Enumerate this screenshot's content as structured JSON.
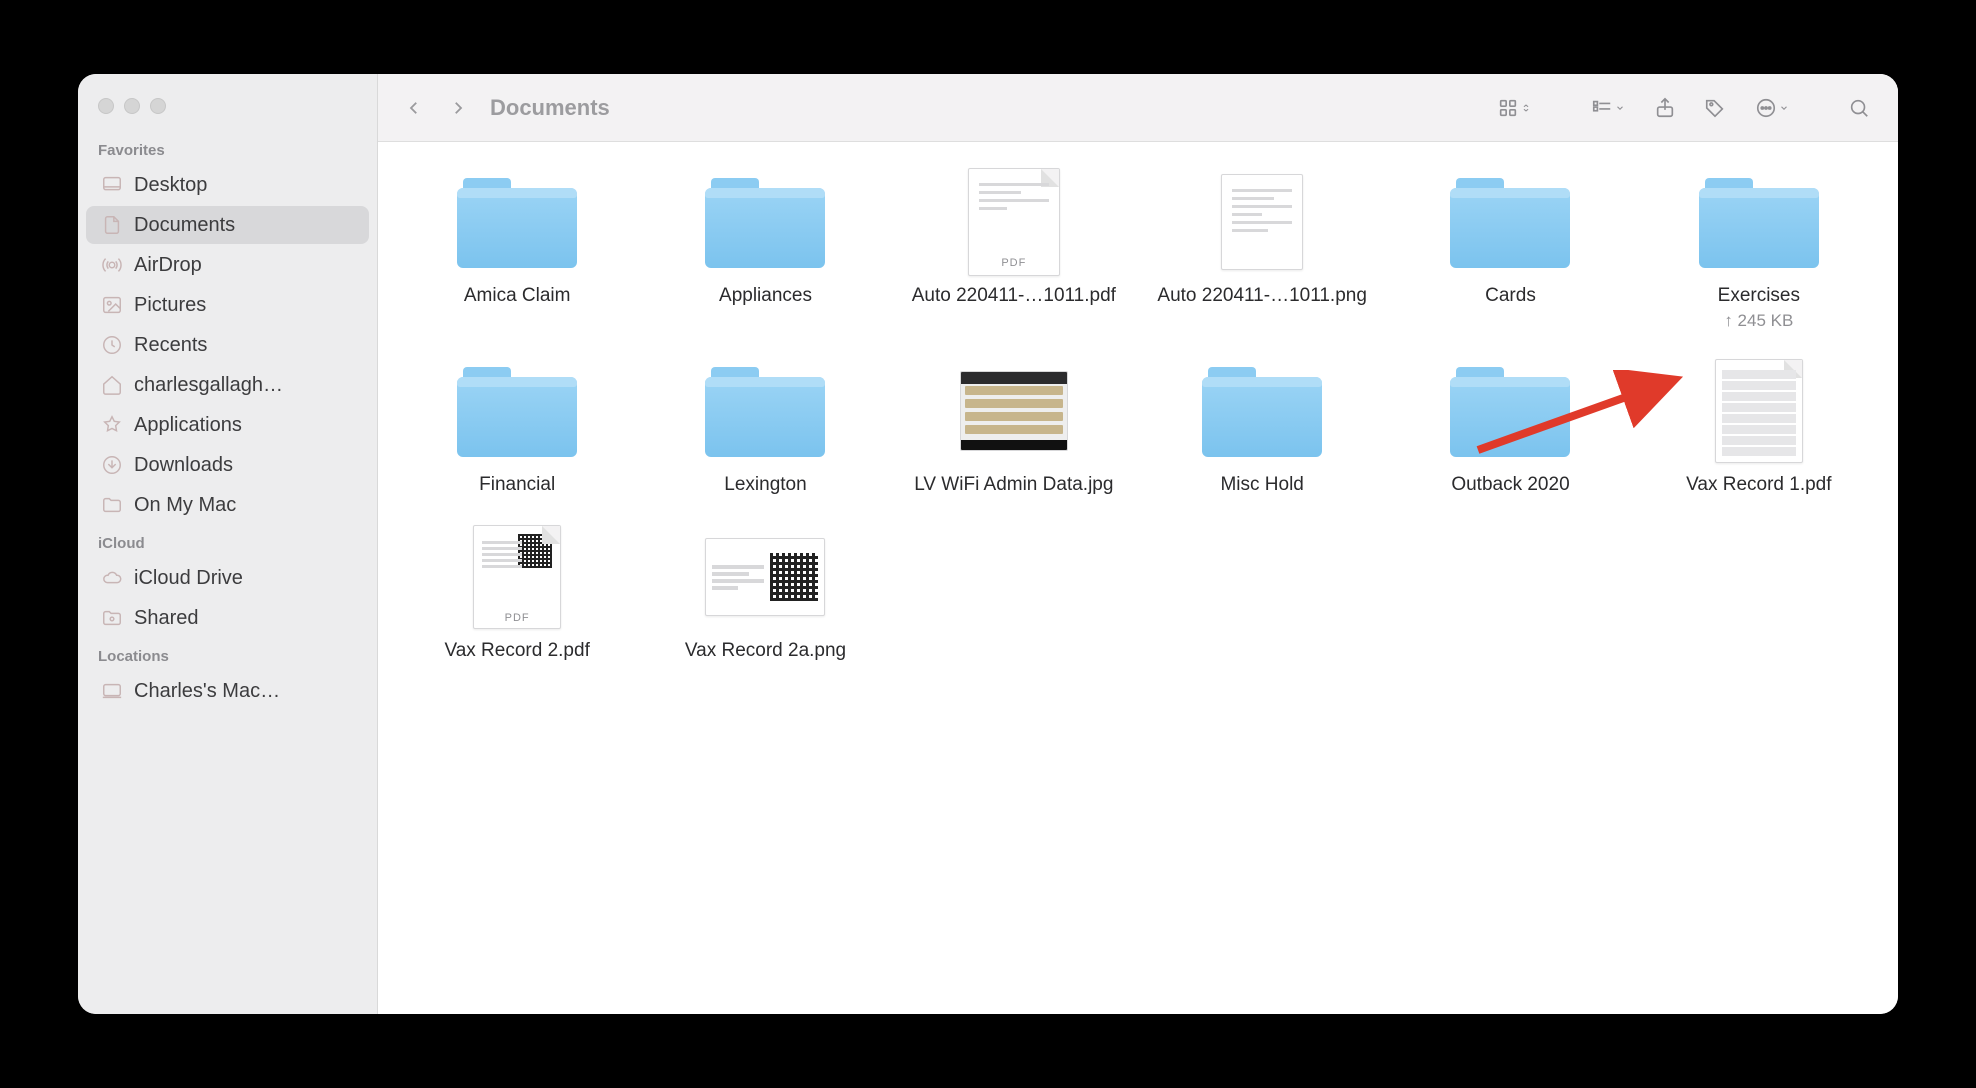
{
  "window": {
    "title": "Documents"
  },
  "sidebar": {
    "sections": [
      {
        "label": "Favorites",
        "items": [
          {
            "icon": "desktop",
            "label": "Desktop"
          },
          {
            "icon": "document",
            "label": "Documents",
            "selected": true
          },
          {
            "icon": "airdrop",
            "label": "AirDrop"
          },
          {
            "icon": "pictures",
            "label": "Pictures"
          },
          {
            "icon": "recents",
            "label": "Recents"
          },
          {
            "icon": "home",
            "label": "charlesgallagh…"
          },
          {
            "icon": "applications",
            "label": "Applications"
          },
          {
            "icon": "downloads",
            "label": "Downloads"
          },
          {
            "icon": "folder",
            "label": "On My Mac"
          }
        ]
      },
      {
        "label": "iCloud",
        "items": [
          {
            "icon": "cloud",
            "label": "iCloud Drive"
          },
          {
            "icon": "shared",
            "label": "Shared"
          }
        ]
      },
      {
        "label": "Locations",
        "items": [
          {
            "icon": "mac",
            "label": "Charles's Mac…"
          }
        ]
      }
    ]
  },
  "items": [
    {
      "type": "folder",
      "name": "Amica Claim"
    },
    {
      "type": "folder",
      "name": "Appliances"
    },
    {
      "type": "pdf",
      "name": "Auto 220411-…1011.pdf"
    },
    {
      "type": "docimg",
      "name": "Auto 220411-…1011.png"
    },
    {
      "type": "folder",
      "name": "Cards"
    },
    {
      "type": "folder",
      "name": "Exercises",
      "sub": "↑ 245 KB"
    },
    {
      "type": "folder",
      "name": "Financial"
    },
    {
      "type": "folder",
      "name": "Lexington"
    },
    {
      "type": "photo",
      "name": "LV WiFi Admin Data.jpg"
    },
    {
      "type": "folder",
      "name": "Misc Hold"
    },
    {
      "type": "folder",
      "name": "Outback 2020"
    },
    {
      "type": "vaxdoc",
      "name": "Vax Record 1.pdf"
    },
    {
      "type": "vaxpdf",
      "name": "Vax Record 2.pdf"
    },
    {
      "type": "qrcard",
      "name": "Vax Record 2a.png"
    }
  ],
  "pdf_tag": "PDF"
}
